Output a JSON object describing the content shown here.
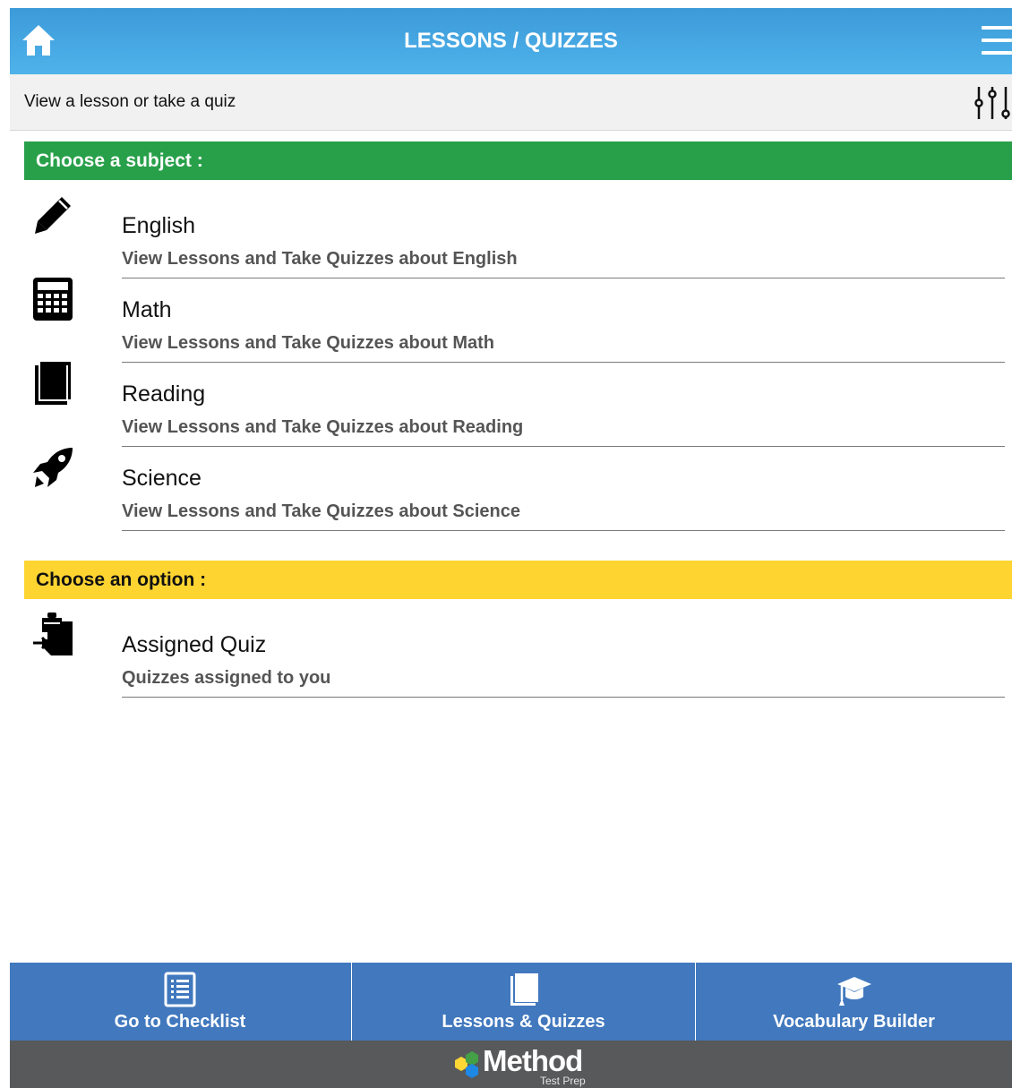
{
  "header": {
    "title": "LESSONS / QUIZZES"
  },
  "subheader": {
    "text": "View a lesson or take a quiz"
  },
  "subjects": {
    "heading": "Choose a subject :",
    "items": [
      {
        "name": "English",
        "description": "View Lessons and Take Quizzes about English",
        "icon": "pencil-icon"
      },
      {
        "name": "Math",
        "description": "View Lessons and Take Quizzes about Math",
        "icon": "calculator-icon"
      },
      {
        "name": "Reading",
        "description": "View Lessons and Take Quizzes about Reading",
        "icon": "book-icon"
      },
      {
        "name": "Science",
        "description": "View Lessons and Take Quizzes about Science",
        "icon": "rocket-icon"
      }
    ]
  },
  "options": {
    "heading": "Choose an option :",
    "items": [
      {
        "name": "Assigned Quiz",
        "description": "Quizzes assigned to you",
        "icon": "clipboard-assign-icon"
      }
    ]
  },
  "bottom_nav": {
    "items": [
      {
        "label": "Go to Checklist",
        "icon": "checklist-icon"
      },
      {
        "label": "Lessons & Quizzes",
        "icon": "book-icon"
      },
      {
        "label": "Vocabulary Builder",
        "icon": "graduation-cap-icon"
      }
    ]
  },
  "footer": {
    "logo_word": "Method",
    "logo_sub": "Test Prep"
  },
  "colors": {
    "header_blue": "#3c9ad9",
    "subject_green": "#28a04a",
    "option_yellow": "#fed431",
    "nav_blue": "#4178be",
    "footer_gray": "#58595b"
  }
}
